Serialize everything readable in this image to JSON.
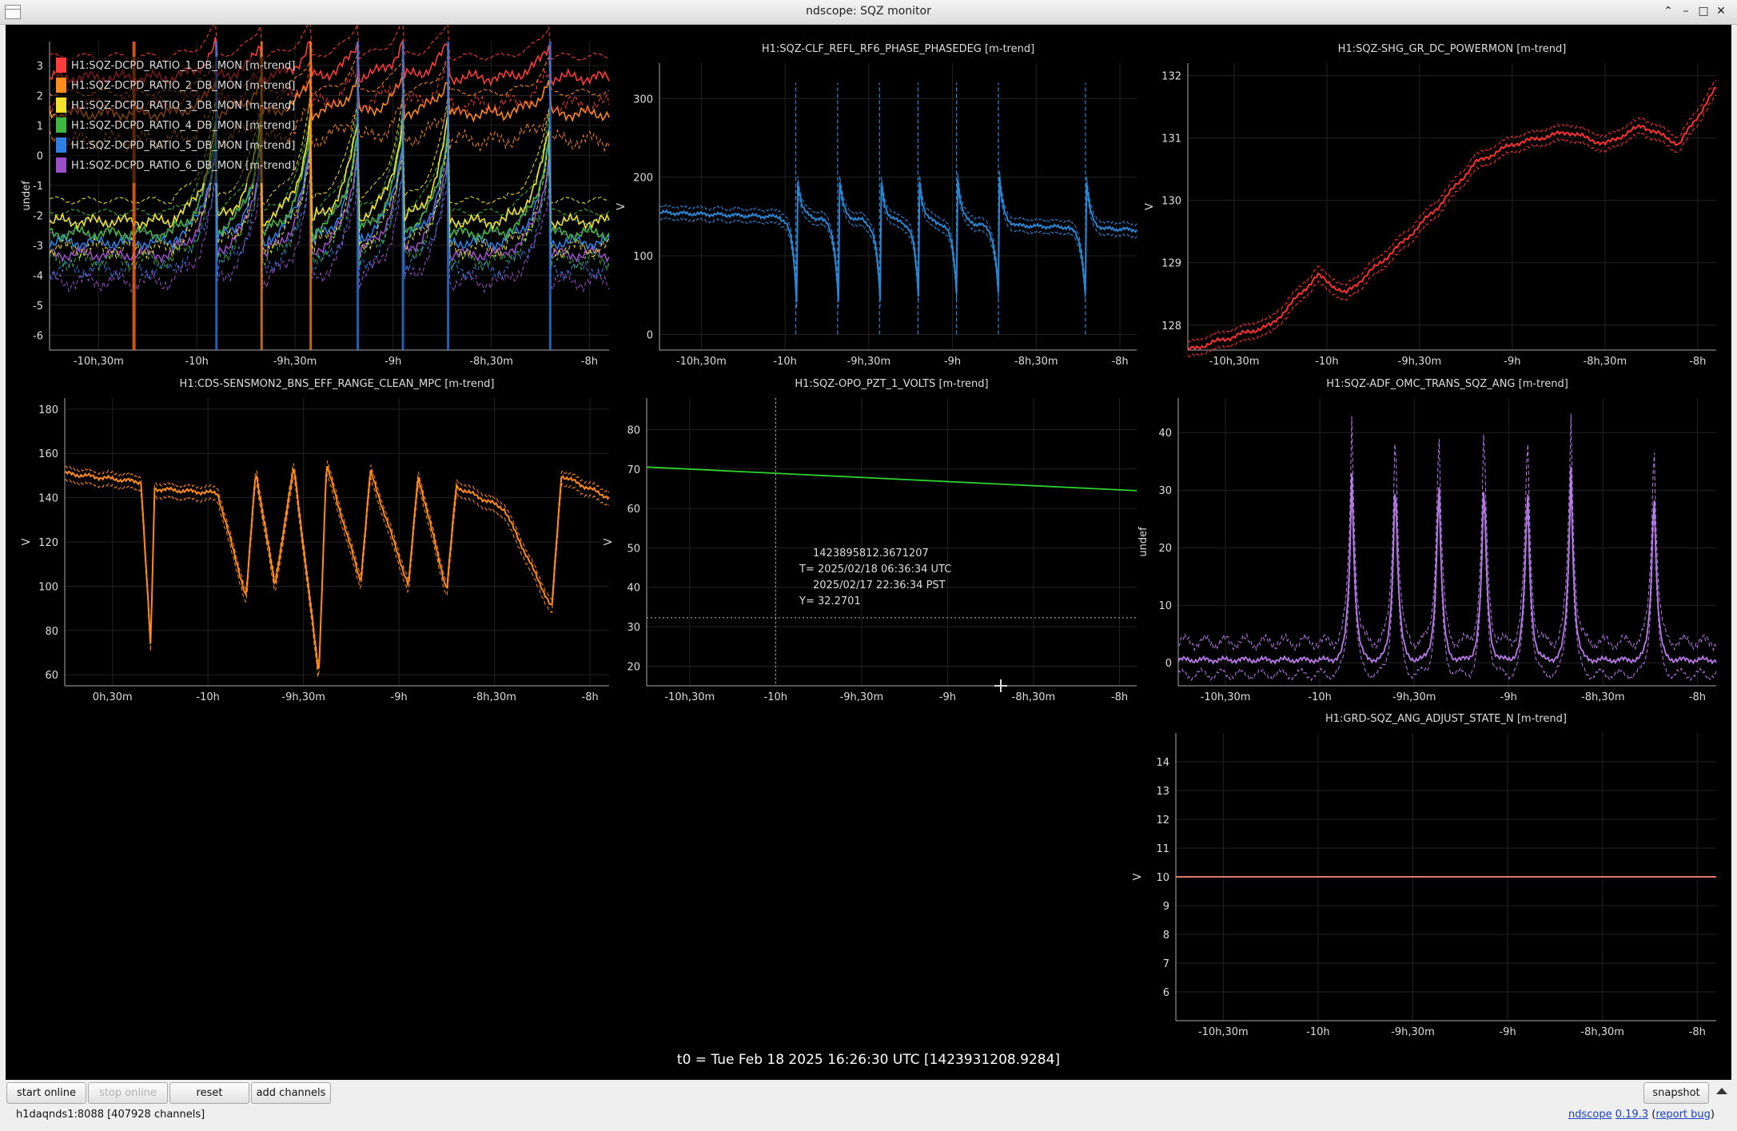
{
  "window": {
    "title": "ndscope: SQZ monitor"
  },
  "time_axis_ticks": [
    "-10h,30m",
    "-10h",
    "-9h,30m",
    "-9h",
    "-8h,30m",
    "-8h"
  ],
  "plots": [
    {
      "id": "dcpd",
      "title": "",
      "ylabel": "undef",
      "yticks": [
        "3",
        "2",
        "1",
        "0",
        "-1",
        "-2",
        "-3",
        "-4",
        "-5",
        "-6"
      ],
      "xticks": [
        "-10h,30m",
        "-10h",
        "-9h,30m",
        "-9h",
        "-8h,30m",
        "-8h"
      ],
      "legend": [
        {
          "label": "H1:SQZ-DCPD_RATIO_1_DB_MON [m-trend]",
          "color": "#ff3b3b"
        },
        {
          "label": "H1:SQZ-DCPD_RATIO_2_DB_MON [m-trend]",
          "color": "#ff8a1e"
        },
        {
          "label": "H1:SQZ-DCPD_RATIO_3_DB_MON [m-trend]",
          "color": "#f2e22a"
        },
        {
          "label": "H1:SQZ-DCPD_RATIO_4_DB_MON [m-trend]",
          "color": "#3fb63f"
        },
        {
          "label": "H1:SQZ-DCPD_RATIO_5_DB_MON [m-trend]",
          "color": "#2f7fe6"
        },
        {
          "label": "H1:SQZ-DCPD_RATIO_6_DB_MON [m-trend]",
          "color": "#9a4fc8"
        }
      ]
    },
    {
      "id": "clf",
      "title": "H1:SQZ-CLF_REFL_RF6_PHASE_PHASEDEG [m-trend]",
      "ylabel": "V",
      "yticks": [
        "300",
        "200",
        "100",
        "0"
      ],
      "xticks": [
        "-10h,30m",
        "-10h",
        "-9h,30m",
        "-9h",
        "-8h,30m",
        "-8h"
      ],
      "color": "#2b86d2"
    },
    {
      "id": "shg",
      "title": "H1:SQZ-SHG_GR_DC_POWERMON [m-trend]",
      "ylabel": "V",
      "yticks": [
        "132",
        "131",
        "130",
        "129",
        "128"
      ],
      "xticks": [
        "-10h,30m",
        "-10h",
        "-9h,30m",
        "-9h",
        "-8h,30m",
        "-8h"
      ],
      "color": "#ff3030"
    },
    {
      "id": "cds",
      "title": "H1:CDS-SENSMON2_BNS_EFF_RANGE_CLEAN_MPC [m-trend]",
      "ylabel": "V",
      "yticks": [
        "180",
        "160",
        "140",
        "120",
        "100",
        "80",
        "60"
      ],
      "xticks": [
        "0h,30m",
        "-10h",
        "-9h,30m",
        "-9h",
        "-8h,30m",
        "-8h"
      ],
      "color": "#ff8a1a"
    },
    {
      "id": "opo",
      "title": "H1:SQZ-OPO_PZT_1_VOLTS [m-trend]",
      "ylabel": "V",
      "yticks": [
        "80",
        "70",
        "60",
        "50",
        "40",
        "30",
        "20"
      ],
      "xticks": [
        "-10h,30m",
        "-10h",
        "-9h,30m",
        "-9h",
        "-8h,30m",
        "-8h"
      ],
      "color": "#2ed12e",
      "cursor": {
        "gps": "1423895812.3671207",
        "utc": "T= 2025/02/18 06:36:34 UTC",
        "pst": "2025/02/17 22:36:34 PST",
        "y": "Y= 32.2701"
      }
    },
    {
      "id": "adf",
      "title": "H1:SQZ-ADF_OMC_TRANS_SQZ_ANG [m-trend]",
      "ylabel": "undef",
      "yticks": [
        "40",
        "30",
        "20",
        "10",
        "0"
      ],
      "xticks": [
        "-10h,30m",
        "-10h",
        "-9h,30m",
        "-9h",
        "-8h,30m",
        "-8h"
      ],
      "color": "#b77be8"
    },
    {
      "id": "grd",
      "title": "H1:GRD-SQZ_ANG_ADJUST_STATE_N [m-trend]",
      "ylabel": "V",
      "yticks": [
        "14",
        "13",
        "12",
        "11",
        "10",
        "9",
        "8",
        "7",
        "6"
      ],
      "xticks": [
        "-10h,30m",
        "-10h",
        "-9h,30m",
        "-9h",
        "-8h,30m",
        "-8h"
      ],
      "color": "#ff8c78"
    }
  ],
  "t0": "t0 = Tue Feb 18 2025 16:26:30 UTC [1423931208.9284]",
  "buttons": {
    "start_online": "start online",
    "stop_online": "stop online",
    "reset": "reset",
    "add_channels": "add channels",
    "snapshot": "snapshot"
  },
  "status": {
    "server": "h1daqnds1:8088  [407928 channels]"
  },
  "version": {
    "app": "ndscope",
    "ver": "0.19.3",
    "bug": "report bug"
  },
  "chart_data": [
    {
      "type": "line",
      "title": "",
      "ylabel": "undef",
      "ylim": [
        -6.5,
        3.8
      ],
      "x": [
        -10.75,
        -7.8
      ],
      "series": [
        {
          "name": "H1:SQZ-DCPD_RATIO_1_DB_MON [m-trend]",
          "approx_range": [
            2,
            3.6
          ]
        },
        {
          "name": "H1:SQZ-DCPD_RATIO_2_DB_MON [m-trend]",
          "approx_range": [
            0.5,
            2.5
          ]
        },
        {
          "name": "H1:SQZ-DCPD_RATIO_3_DB_MON [m-trend]",
          "approx_range": [
            -3,
            0
          ]
        },
        {
          "name": "H1:SQZ-DCPD_RATIO_4_DB_MON [m-trend]",
          "approx_range": [
            -3.8,
            -1
          ]
        },
        {
          "name": "H1:SQZ-DCPD_RATIO_5_DB_MON [m-trend]",
          "approx_range": [
            -3.8,
            -1
          ]
        },
        {
          "name": "H1:SQZ-DCPD_RATIO_6_DB_MON [m-trend]",
          "approx_range": [
            -4,
            -1.5
          ]
        }
      ]
    },
    {
      "type": "line",
      "title": "H1:SQZ-CLF_REFL_RF6_PHASE_PHASEDEG [m-trend]",
      "ylim": [
        -20,
        345
      ],
      "x": [
        -10.75,
        -7.9
      ],
      "baseline_start": 155,
      "baseline_end": 133,
      "spike_times": [
        -9.93,
        -9.68,
        -9.43,
        -9.2,
        -8.97,
        -8.72,
        -8.2
      ],
      "spike_range": [
        0,
        320
      ]
    },
    {
      "type": "line",
      "title": "H1:SQZ-SHG_GR_DC_POWERMON [m-trend]",
      "ylim": [
        127.6,
        132.2
      ],
      "x": [
        -10.75,
        -8.0,
        -9.0,
        -9.5,
        -8.5,
        -7.9
      ],
      "points": [
        [
          -10.75,
          127.6
        ],
        [
          -10.3,
          128.0
        ],
        [
          -10.05,
          128.8
        ],
        [
          -9.9,
          128.5
        ],
        [
          -9.6,
          129.3
        ],
        [
          -9.4,
          129.9
        ],
        [
          -9.2,
          130.6
        ],
        [
          -9.0,
          130.9
        ],
        [
          -8.7,
          131.1
        ],
        [
          -8.5,
          130.9
        ],
        [
          -8.3,
          131.2
        ],
        [
          -8.1,
          130.9
        ],
        [
          -7.9,
          131.8
        ]
      ]
    },
    {
      "type": "line",
      "title": "H1:CDS-SENSMON2_BNS_EFF_RANGE_CLEAN_MPC [m-trend]",
      "ylim": [
        55,
        185
      ],
      "points": [
        [
          -10.75,
          151
        ],
        [
          -10.35,
          147
        ],
        [
          -10.3,
          72
        ],
        [
          -10.28,
          144
        ],
        [
          -9.95,
          142
        ],
        [
          -9.8,
          95
        ],
        [
          -9.75,
          152
        ],
        [
          -9.65,
          100
        ],
        [
          -9.55,
          154
        ],
        [
          -9.42,
          60
        ],
        [
          -9.38,
          155
        ],
        [
          -9.2,
          102
        ],
        [
          -9.15,
          152
        ],
        [
          -8.95,
          100
        ],
        [
          -8.9,
          150
        ],
        [
          -8.75,
          98
        ],
        [
          -8.7,
          145
        ],
        [
          -8.45,
          135
        ],
        [
          -8.2,
          90
        ],
        [
          -8.15,
          150
        ],
        [
          -7.9,
          140
        ]
      ]
    },
    {
      "type": "line",
      "title": "H1:SQZ-OPO_PZT_1_VOLTS [m-trend]",
      "ylim": [
        15,
        88
      ],
      "points": [
        [
          -10.75,
          70.5
        ],
        [
          -7.9,
          64.5
        ]
      ]
    },
    {
      "type": "line",
      "title": "H1:SQZ-ADF_OMC_TRANS_SQZ_ANG [m-trend]",
      "ylim": [
        -4,
        46
      ],
      "baseline": 0.5,
      "peaks": [
        [
          -9.83,
          43
        ],
        [
          -9.6,
          43
        ],
        [
          -9.37,
          42
        ],
        [
          -9.13,
          42
        ],
        [
          -8.9,
          41
        ],
        [
          -8.67,
          43
        ],
        [
          -8.23,
          40
        ]
      ]
    },
    {
      "type": "line",
      "title": "H1:GRD-SQZ_ANG_ADJUST_STATE_N [m-trend]",
      "ylim": [
        5,
        15
      ],
      "points": [
        [
          -10.75,
          10
        ],
        [
          -7.9,
          10
        ]
      ]
    }
  ]
}
